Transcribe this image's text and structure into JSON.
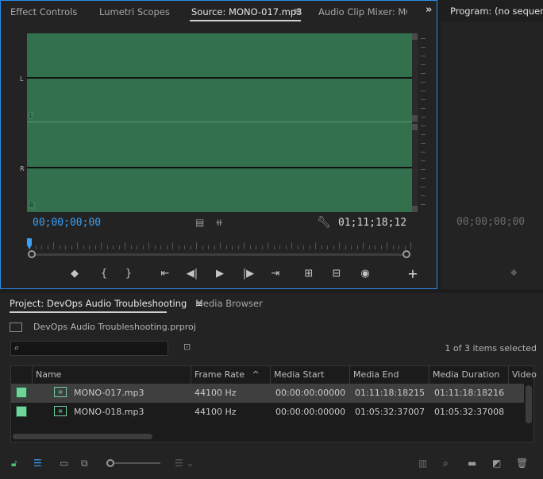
{
  "source_panel": {
    "tabs": [
      "Effect Controls",
      "Lumetri Scopes",
      "Source: MONO-017.mp3",
      "Audio Clip Mixer: MON"
    ],
    "active_tab": "Source: MONO-017.mp3",
    "menu_glyph": "≡",
    "overflow_glyph": "»",
    "channels": [
      "L",
      "R"
    ],
    "current_timecode": "00;00;00;00",
    "duration_timecode": "01;11;18;12",
    "icons": {
      "drag_video": "film-icon",
      "drag_audio": "waveform-icon",
      "settings": "wrench-icon"
    },
    "transport": [
      "marker-icon",
      "mark-in-icon",
      "mark-out-icon",
      "go-to-in-icon",
      "step-back-icon",
      "play-icon",
      "step-forward-icon",
      "go-to-out-icon",
      "insert-icon",
      "overwrite-icon",
      "export-frame-icon",
      "add-button-icon"
    ],
    "transport_glyphs": [
      "◆",
      "{",
      "}",
      "⇤",
      "◀|",
      "▶",
      "|▶",
      "⇥",
      "⊞",
      "⊟",
      "◉",
      "+"
    ],
    "accent_color": "#2d8ceb",
    "waveform_color": "#33714e"
  },
  "program_panel": {
    "title": "Program: (no sequences",
    "timecode": "00;00;00;00",
    "marker_glyph": "◆"
  },
  "project_panel": {
    "tab_label": "Project: DevOps Audio Troubleshooting",
    "menu_glyph": "≡",
    "media_browser_label": "Media Browser",
    "project_file": "DevOps Audio Troubleshooting.prproj",
    "search_placeholder": "",
    "items_selected": "1 of 3 items selected",
    "columns": [
      "Name",
      "Frame Rate",
      "Media Start",
      "Media End",
      "Media Duration",
      "Video"
    ],
    "sort_glyph": "^",
    "rows": [
      {
        "name": "MONO-017.mp3",
        "frame_rate": "44100 Hz",
        "media_start": "00:00:00:00000",
        "media_end": "01:11:18:18215",
        "media_duration": "01:11:18:18216",
        "selected": true
      },
      {
        "name": "MONO-018.mp3",
        "frame_rate": "44100 Hz",
        "media_start": "00:00:00:00000",
        "media_end": "01:05:32:37007",
        "media_duration": "01:05:32:37008",
        "selected": false
      }
    ],
    "label_color": "#6fd49a",
    "bottom_icons": [
      "lock-icon",
      "list-view-icon",
      "icon-view-icon",
      "freeform-view-icon",
      "zoom-slider",
      "sort-icon",
      "automate-icon",
      "find-icon",
      "new-bin-icon",
      "new-item-icon",
      "trash-icon"
    ]
  }
}
